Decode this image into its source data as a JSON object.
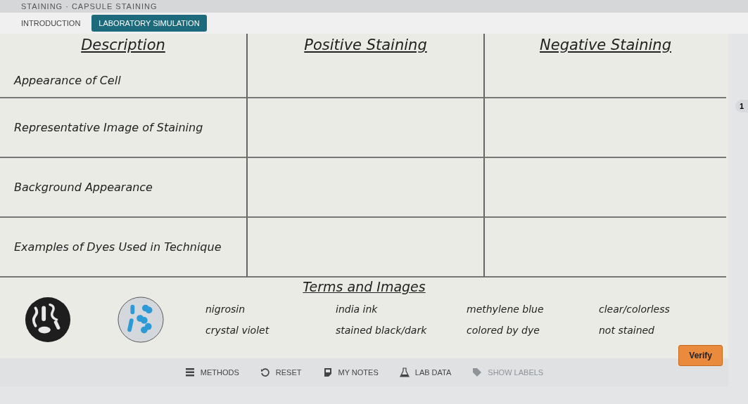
{
  "breadcrumb": "STAINING · CAPSULE STAINING",
  "tabs": [
    {
      "label": "INTRODUCTION",
      "selected": false
    },
    {
      "label": "LABORATORY SIMULATION",
      "selected": true
    }
  ],
  "table": {
    "columns": [
      "Description",
      "Positive Staining",
      "Negative Staining"
    ],
    "rows": [
      "Appearance of Cell",
      "Representative Image of Staining",
      "Background Appearance",
      "Examples of Dyes Used in Technique"
    ]
  },
  "terms": {
    "title": "Terms and Images",
    "images": [
      {
        "kind": "dark-background"
      },
      {
        "kind": "blue-cells"
      }
    ],
    "items": [
      "nigrosin",
      "india ink",
      "methylene blue",
      "clear/colorless",
      "crystal violet",
      "stained black/dark",
      "colored by dye",
      "not stained"
    ]
  },
  "verify_button": "Verify",
  "page_badge": "1",
  "toolbar": [
    {
      "label": "METHODS",
      "kind": "methods",
      "disabled": false
    },
    {
      "label": "RESET",
      "kind": "reset",
      "disabled": false
    },
    {
      "label": "MY NOTES",
      "kind": "notes",
      "disabled": false
    },
    {
      "label": "LAB DATA",
      "kind": "flask",
      "disabled": false
    },
    {
      "label": "SHOW LABELS",
      "kind": "tag",
      "disabled": true
    }
  ]
}
